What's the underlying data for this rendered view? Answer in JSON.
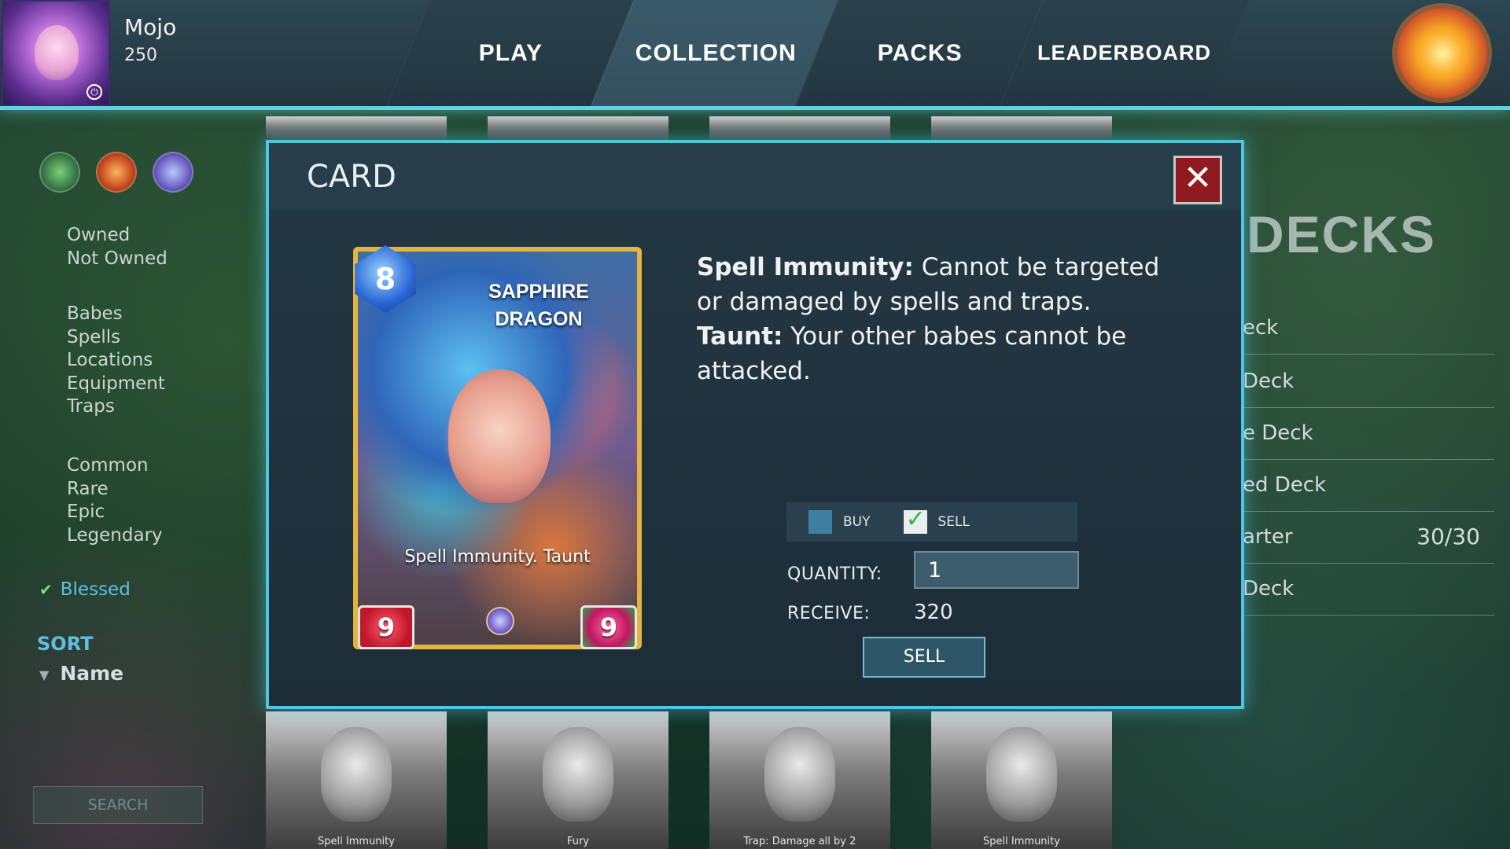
{
  "player": {
    "name": "Mojo",
    "coins": "250"
  },
  "nav": {
    "tabs": [
      "PLAY",
      "COLLECTION",
      "PACKS",
      "LEADERBOARD"
    ],
    "active": "COLLECTION"
  },
  "sidebar": {
    "element_icons": [
      "nature-icon",
      "fire-icon",
      "water-icon"
    ],
    "ownership": [
      "Owned",
      "Not Owned"
    ],
    "types": [
      "Babes",
      "Spells",
      "Locations",
      "Equipment",
      "Traps"
    ],
    "rarities": [
      "Common",
      "Rare",
      "Epic",
      "Legendary"
    ],
    "blessed": "Blessed",
    "sort_title": "SORT",
    "sort_by": "Name",
    "search_placeholder": "SEARCH"
  },
  "decks": {
    "title": "DECKS",
    "rows": [
      {
        "label": "eck",
        "count": ""
      },
      {
        "label": "Deck",
        "count": ""
      },
      {
        "label": "e Deck",
        "count": ""
      },
      {
        "label": "ed Deck",
        "count": ""
      },
      {
        "label": "arter",
        "count": "30/30"
      },
      {
        "label": "Deck",
        "count": ""
      }
    ]
  },
  "card_strip": {
    "bottom_captions": [
      "Spell Immunity",
      "Fury",
      "Trap: Damage all by 2",
      "Spell Immunity"
    ]
  },
  "modal": {
    "title": "CARD",
    "close_label": "✕",
    "card": {
      "cost": "8",
      "name_line1": "SAPPHIRE",
      "name_line2": "DRAGON",
      "keywords": "Spell Immunity. Taunt",
      "attack": "9",
      "health": "9"
    },
    "description": {
      "kw1": "Spell Immunity:",
      "text1": " Cannot be targeted or damaged by spells and traps.",
      "kw2": "Taunt:",
      "text2": " Your other babes cannot be attacked."
    },
    "trade": {
      "buy_label": "BUY",
      "sell_label": "SELL",
      "selected": "SELL",
      "quantity_label": "QUANTITY:",
      "quantity_value": "1",
      "receive_label": "RECEIVE:",
      "receive_value": "320",
      "sell_button": "SELL"
    }
  },
  "colors": {
    "accent": "#4fc6e0",
    "close_button": "#8e1b1f",
    "card_border": "#e3b540"
  }
}
